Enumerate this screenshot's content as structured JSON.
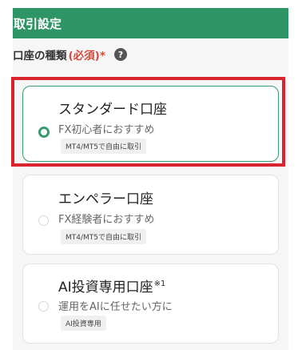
{
  "header": {
    "title": "取引設定"
  },
  "section": {
    "label": "口座の種類",
    "required": "(必須)*",
    "help_glyph": "?"
  },
  "account_types": [
    {
      "title": "スタンダード口座",
      "sup": "",
      "description": "FX初心者におすすめ",
      "badge": "MT4/MT5で自由に取引",
      "selected": true
    },
    {
      "title": "エンペラー口座",
      "sup": "",
      "description": "FX経験者におすすめ",
      "badge": "MT4/MT5で自由に取引",
      "selected": false
    },
    {
      "title": "AI投資専用口座",
      "sup": "※1",
      "description": "運用をAIに任せたい方に",
      "badge": "AI投資専用",
      "selected": false
    }
  ],
  "colors": {
    "accent": "#2f9466",
    "highlight": "#d9232e",
    "required": "#d14a3c"
  }
}
